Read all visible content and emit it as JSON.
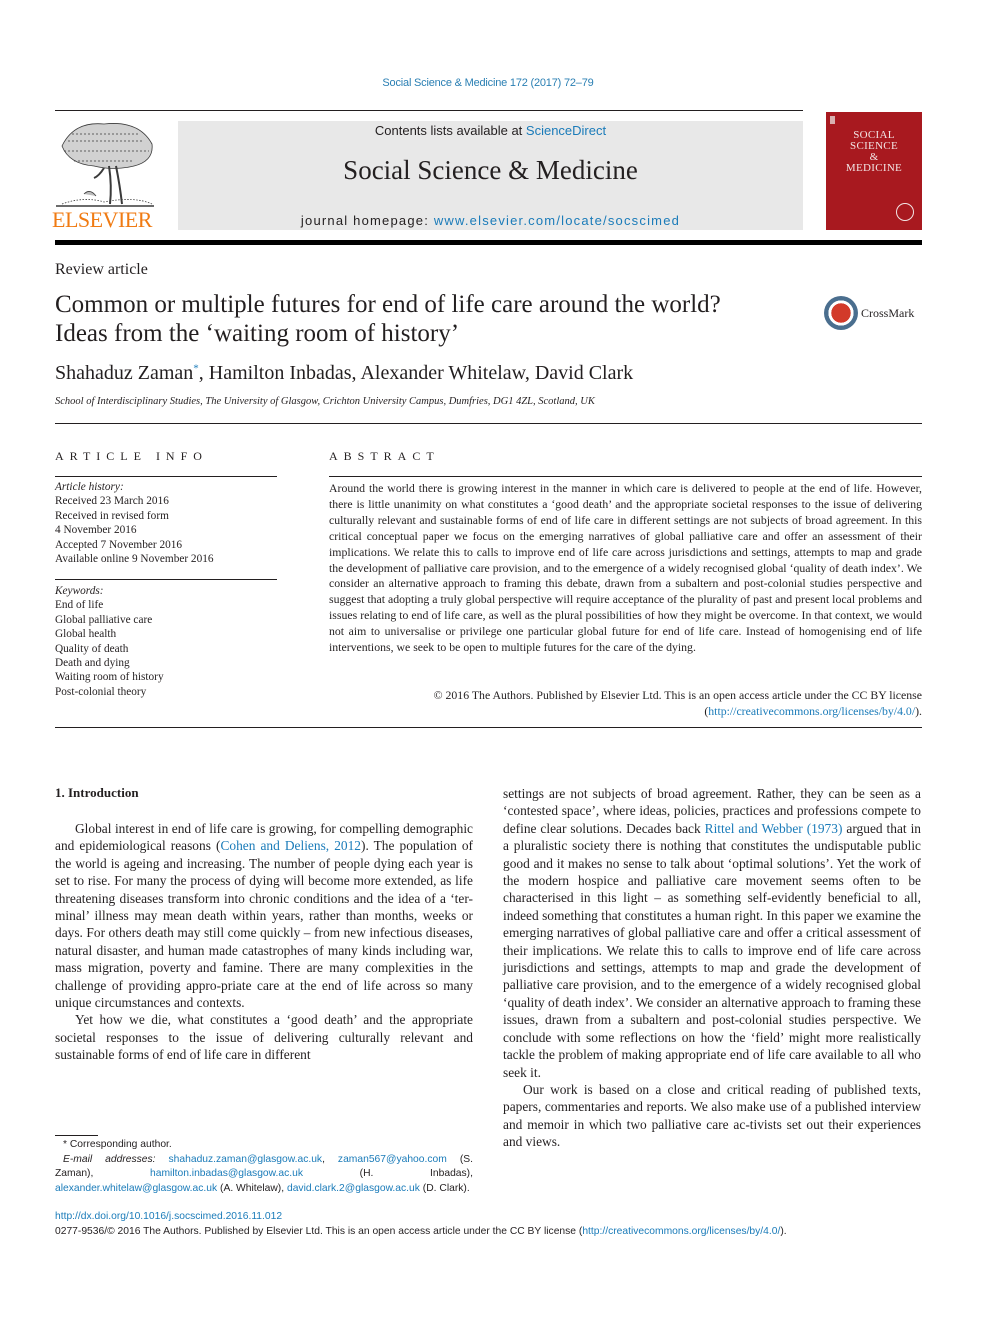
{
  "running_head": "Social Science & Medicine 172 (2017) 72–79",
  "masthead": {
    "publisher_logo_text": "ELSEVIER",
    "contents_prefix": "Contents lists available at ",
    "contents_link": "ScienceDirect",
    "journal_title": "Social Science & Medicine",
    "homepage_prefix": "journal homepage: ",
    "homepage_link": "www.elsevier.com/locate/socscimed",
    "cover_title_lines": [
      "SOCIAL",
      "SCIENCE",
      "&",
      "MEDICINE"
    ],
    "colors": {
      "publisher_orange": "#f07b13",
      "link_blue": "#1a7bb9",
      "cover_red": "#a8191f",
      "masthead_gray": "#e8e8e8"
    }
  },
  "article": {
    "type": "Review article",
    "title_line1": "Common or multiple futures for end of life care around the world?",
    "title_line2": "Ideas from the ‘waiting room of history’",
    "crossmark_label": "CrossMark",
    "authors": [
      {
        "name": "Shahaduz Zaman",
        "mark": "*"
      },
      {
        "name": "Hamilton Inbadas"
      },
      {
        "name": "Alexander Whitelaw"
      },
      {
        "name": "David Clark"
      }
    ],
    "author_sep": ", ",
    "affiliation": "School of Interdisciplinary Studies, The University of Glasgow, Crichton University Campus, Dumfries, DG1 4ZL, Scotland, UK"
  },
  "article_info": {
    "heading": "ARTICLE INFO",
    "history_label": "Article history:",
    "history": [
      "Received 23 March 2016",
      "Received in revised form",
      "4 November 2016",
      "Accepted 7 November 2016",
      "Available online 9 November 2016"
    ],
    "keywords_label": "Keywords:",
    "keywords": [
      "End of life",
      "Global palliative care",
      "Global health",
      "Quality of death",
      "Death and dying",
      "Waiting room of history",
      "Post-colonial theory"
    ]
  },
  "abstract": {
    "heading": "ABSTRACT",
    "text": "Around the world there is growing interest in the manner in which care is delivered to people at the end of life. However, there is little unanimity on what constitutes a ‘good death’ and the appropriate societal responses to the issue of delivering culturally relevant and sustainable forms of end of life care in different settings are not subjects of broad agreement. In this critical conceptual paper we focus on the emerging narratives of global palliative care and offer an assessment of their implications. We relate this to calls to improve end of life care across jurisdictions and settings, attempts to map and grade the development of palliative care provision, and to the emergence of a widely recognised global ‘quality of death index’. We consider an alternative approach to framing this debate, drawn from a subaltern and post-colonial studies perspective and suggest that adopting a truly global perspective will require acceptance of the plurality of past and present local problems and issues relating to end of life care, as well as the plural possibilities of how they might be overcome. In that context, we would not aim to universalise or privilege one particular global future for end of life care. Instead of homogenising end of life interventions, we seek to be open to multiple futures for the care of the dying.",
    "copyright": "© 2016 The Authors. Published by Elsevier Ltd. This is an open access article under the CC BY license",
    "license_open": "(",
    "license_link": "http://creativecommons.org/licenses/by/4.0/",
    "license_close": ")."
  },
  "body": {
    "section_heading": "1.  Introduction",
    "p1_a": "Global interest in end of life care is growing, for compelling demographic and epidemiological reasons (",
    "p1_cite": "Cohen and Deliens, 2012",
    "p1_b": "). The population of the world is ageing and increasing. The number of people dying each year is set to rise. For many the process of dying will become more extended, as life threatening diseases transform into chronic conditions and the idea of a ‘ter-minal’ illness may mean death within years, rather than months, weeks or days. For others death may still come quickly – from new infectious diseases, natural disaster, and human made catastrophes of many kinds including war, mass migration, poverty and famine. There are many complexities in the challenge of providing appro-priate care at the end of life across so many unique circumstances and contexts.",
    "p2": "Yet how we die, what constitutes a ‘good death’ and the appropriate societal responses to the issue of delivering culturally relevant and sustainable forms of end of life care in different",
    "p2_cont_a": "settings are not subjects of broad agreement. Rather, they can be seen as a ‘contested space’, where ideas, policies, practices and professions compete to define clear solutions. Decades back ",
    "p2_cite": "Rittel and Webber (1973)",
    "p2_cont_b": " argued that in a pluralistic society there is nothing that constitutes the undisputable public good and it makes no sense to talk about ‘optimal solutions’. Yet the work of the modern hospice and palliative care movement seems often to be characterised in this light – as something self-evidently beneficial to all, indeed something that constitutes a human right. In this paper we examine the emerging narratives of global palliative care and offer a critical assessment of their implications. We relate this to calls to improve end of life care across jurisdictions and settings, attempts to map and grade the development of palliative care provision, and to the emergence of a widely recognised global ‘quality of death index’. We consider an alternative approach to framing these issues, drawn from a subaltern and post-colonial studies perspective. We conclude with some reflections on how the ‘field’ might more realistically tackle the problem of making appropriate end of life care available to all who seek it.",
    "p3": "Our work is based on a close and critical reading of published texts, papers, commentaries and reports. We also make use of a published interview and memoir in which two palliative care ac-tivists set out their experiences and views."
  },
  "footnote": {
    "corresponding": "* Corresponding author.",
    "email_label": "E-mail addresses:",
    "emails": [
      {
        "address": "shahaduz.zaman@glasgow.ac.uk",
        "owner": ""
      },
      {
        "address": "zaman567@yahoo.com",
        "owner": "(S. Zaman)"
      },
      {
        "address": "hamilton.inbadas@glasgow.ac.uk",
        "owner": "(H. Inbadas)"
      },
      {
        "address": "alexander.whitelaw@glasgow.ac.uk",
        "owner": "(A. Whitelaw)"
      },
      {
        "address": "david.clark.2@glasgow.ac.uk",
        "owner": "(D. Clark)."
      }
    ]
  },
  "page_footer": {
    "doi": "http://dx.doi.org/10.1016/j.socscimed.2016.11.012",
    "issn_prefix": "0277-9536/© 2016 The Authors. Published by Elsevier Ltd. This is an open access article under the CC BY license (",
    "issn_link": "http://creativecommons.org/licenses/by/4.0/",
    "issn_suffix": ")."
  }
}
